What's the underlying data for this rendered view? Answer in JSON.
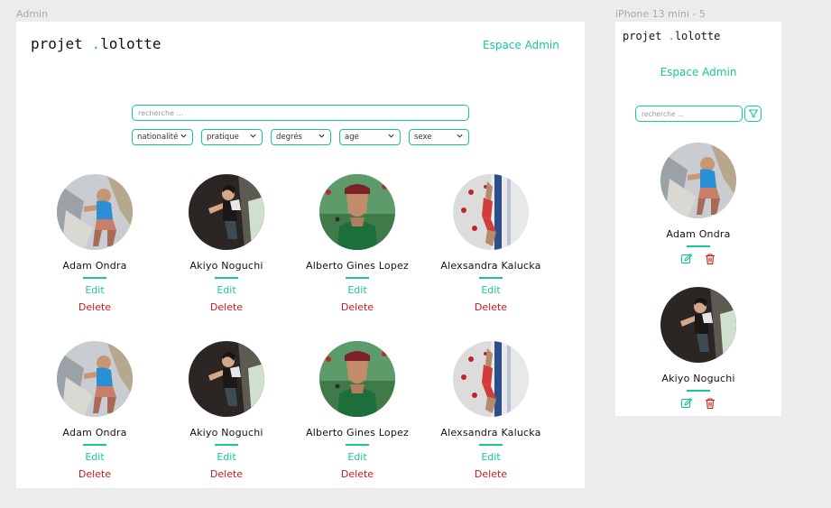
{
  "desktop_frame": {
    "label": "Admin",
    "logo": {
      "part1": "projet ",
      "dot": ".",
      "part2": "lolotte"
    },
    "admin_link": "Espace Admin",
    "search_placeholder": "recherche ...",
    "filters": [
      {
        "label": "nationalité"
      },
      {
        "label": "pratique"
      },
      {
        "label": "degrés"
      },
      {
        "label": "age"
      },
      {
        "label": "sexe"
      }
    ],
    "edit_label": "Edit",
    "delete_label": "Delete",
    "athletes": [
      {
        "name": "Adam Ondra",
        "photo": "photo-adam"
      },
      {
        "name": "Akiyo Noguchi",
        "photo": "photo-akiyo"
      },
      {
        "name": "Alberto Gines Lopez",
        "photo": "photo-alberto"
      },
      {
        "name": "Alexsandra Kalucka",
        "photo": "photo-alexsandra"
      },
      {
        "name": "Adam Ondra",
        "photo": "photo-adam"
      },
      {
        "name": "Akiyo Noguchi",
        "photo": "photo-akiyo"
      },
      {
        "name": "Alberto Gines Lopez",
        "photo": "photo-alberto"
      },
      {
        "name": "Alexsandra Kalucka",
        "photo": "photo-alexsandra"
      }
    ]
  },
  "mobile_frame": {
    "label": "iPhone 13 mini - 5",
    "logo": {
      "part1": "projet ",
      "dot": ".",
      "part2": "lolotte"
    },
    "admin_link": "Espace Admin",
    "search_placeholder": "recherche ...",
    "filter_icon": "filter-icon",
    "athletes": [
      {
        "name": "Adam Ondra",
        "photo": "photo-adam"
      },
      {
        "name": "Akiyo Noguchi",
        "photo": "photo-akiyo"
      }
    ],
    "edit_icon": "edit-icon",
    "delete_icon": "trash-icon"
  },
  "colors": {
    "accent": "#16c79a",
    "danger": "#d0191b",
    "canvas": "#ececec",
    "frame": "#ffffff"
  }
}
